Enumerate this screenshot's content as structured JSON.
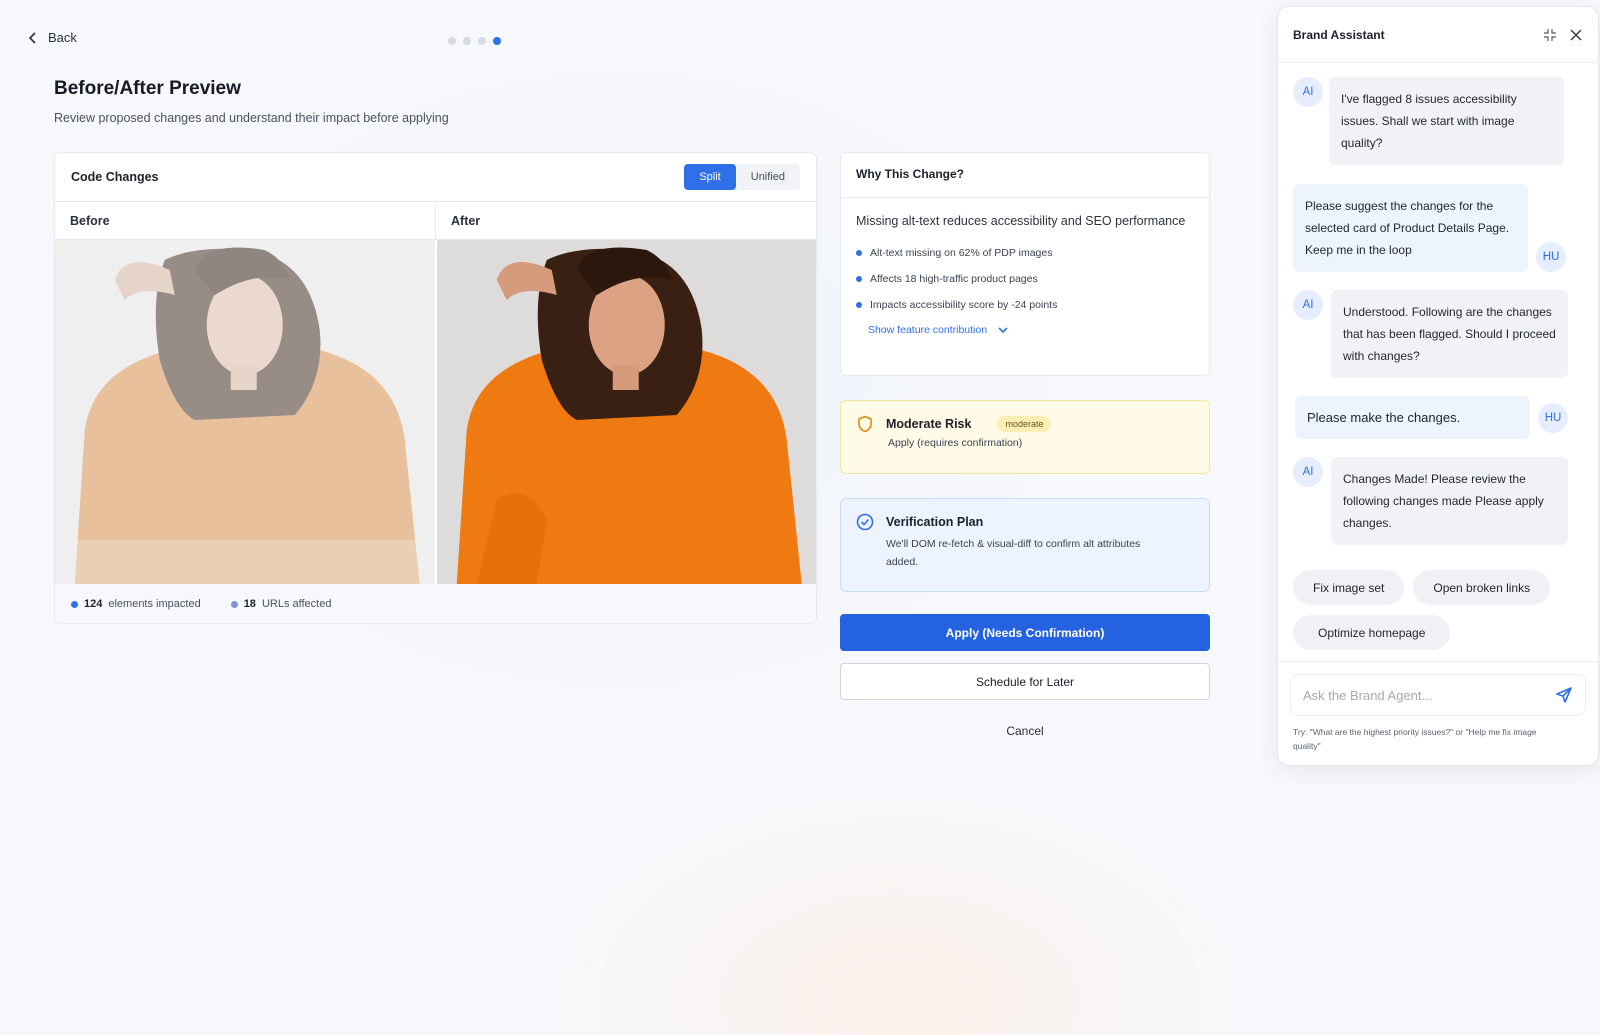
{
  "nav": {
    "back_label": "Back",
    "steps": 4,
    "active_step": 4
  },
  "header": {
    "title": "Before/After Preview",
    "subtitle": "Review proposed changes and understand their impact before applying"
  },
  "code_changes": {
    "title": "Code Changes",
    "view_toggle": {
      "split_label": "Split",
      "unified_label": "Unified",
      "selected": "Split"
    },
    "before_label": "Before",
    "after_label": "After",
    "stats": {
      "elements_count": "124",
      "elements_label": "elements impacted",
      "urls_count": "18",
      "urls_label": "URLs affected"
    }
  },
  "why": {
    "title": "Why This Change?",
    "summary": "Missing alt-text reduces accessibility and SEO performance",
    "bullets": [
      "Alt-text missing on 62% of PDP images",
      "Affects 18 high-traffic product pages",
      "Impacts accessibility score by -24 points"
    ],
    "link_label": "Show feature contribution"
  },
  "risk": {
    "title": "Moderate Risk",
    "badge": "moderate",
    "subtitle": "Apply (requires confirmation)"
  },
  "verification": {
    "title": "Verification Plan",
    "description": "We'll DOM re-fetch & visual-diff to confirm alt attributes added."
  },
  "actions": {
    "apply_label": "Apply (Needs Confirmation)",
    "schedule_label": "Schedule for Later",
    "cancel_label": "Cancel"
  },
  "chat": {
    "title": "Brand Assistant",
    "messages": [
      {
        "sender": "AI",
        "text": "I've flagged 8 issues accessibility issues. Shall we start with image quality?"
      },
      {
        "sender": "HU",
        "text": "Please suggest the changes for the selected card of Product Details Page. Keep me in the loop"
      },
      {
        "sender": "AI",
        "text": "Understood. Following are the changes that has been flagged. Should I proceed with changes?"
      },
      {
        "sender": "HU",
        "text": "Please make the changes."
      },
      {
        "sender": "AI",
        "text": "Changes Made! Please review the following changes made Please apply changes."
      }
    ],
    "suggestions": [
      "Fix image set",
      "Open broken links",
      "Optimize homepage"
    ],
    "input_placeholder": "Ask the Brand Agent...",
    "hint": "Try: \"What are the highest priority issues?\" or \"Help me fix image quality\""
  },
  "colors": {
    "accent": "#2f6fe8",
    "primary_button": "#2462e0",
    "risk_bg": "#fffbe6",
    "verify_bg": "#eef4ff",
    "sweater": "#f08a2a"
  }
}
